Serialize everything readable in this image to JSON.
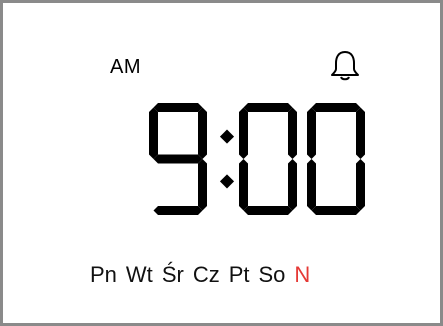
{
  "clock": {
    "period": "AM",
    "time": "9:00",
    "alarm_icon": "bell-icon"
  },
  "weekdays": [
    {
      "label": "Pn",
      "active": false
    },
    {
      "label": "Wt",
      "active": false
    },
    {
      "label": "Śr",
      "active": false
    },
    {
      "label": "Cz",
      "active": false
    },
    {
      "label": "Pt",
      "active": false
    },
    {
      "label": "So",
      "active": false
    },
    {
      "label": "N",
      "active": true
    }
  ],
  "colors": {
    "digits": "#000000",
    "today": "#e53935",
    "frame": "#8a8a8a"
  }
}
